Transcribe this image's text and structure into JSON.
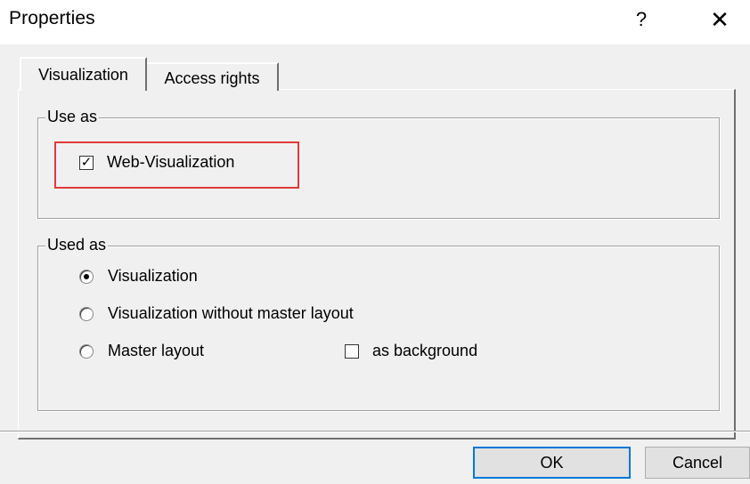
{
  "window": {
    "title": "Properties",
    "help_label": "?",
    "close_label": "✕"
  },
  "tabs": [
    {
      "label": "Visualization",
      "active": true
    },
    {
      "label": "Access rights",
      "active": false
    }
  ],
  "use_as": {
    "legend": "Use as",
    "web_visualization": {
      "label": "Web-Visualization",
      "checked": true,
      "check_glyph": "✓"
    }
  },
  "used_as": {
    "legend": "Used as",
    "options": [
      {
        "label": "Visualization",
        "selected": true
      },
      {
        "label": "Visualization without master layout",
        "selected": false
      },
      {
        "label": "Master layout",
        "selected": false
      }
    ],
    "as_background": {
      "label": "as background",
      "checked": false
    }
  },
  "buttons": {
    "ok": "OK",
    "cancel": "Cancel"
  },
  "colors": {
    "highlight": "#e03a3a",
    "default_button_border": "#0078d7",
    "dialog_background": "#f0f0f0"
  }
}
